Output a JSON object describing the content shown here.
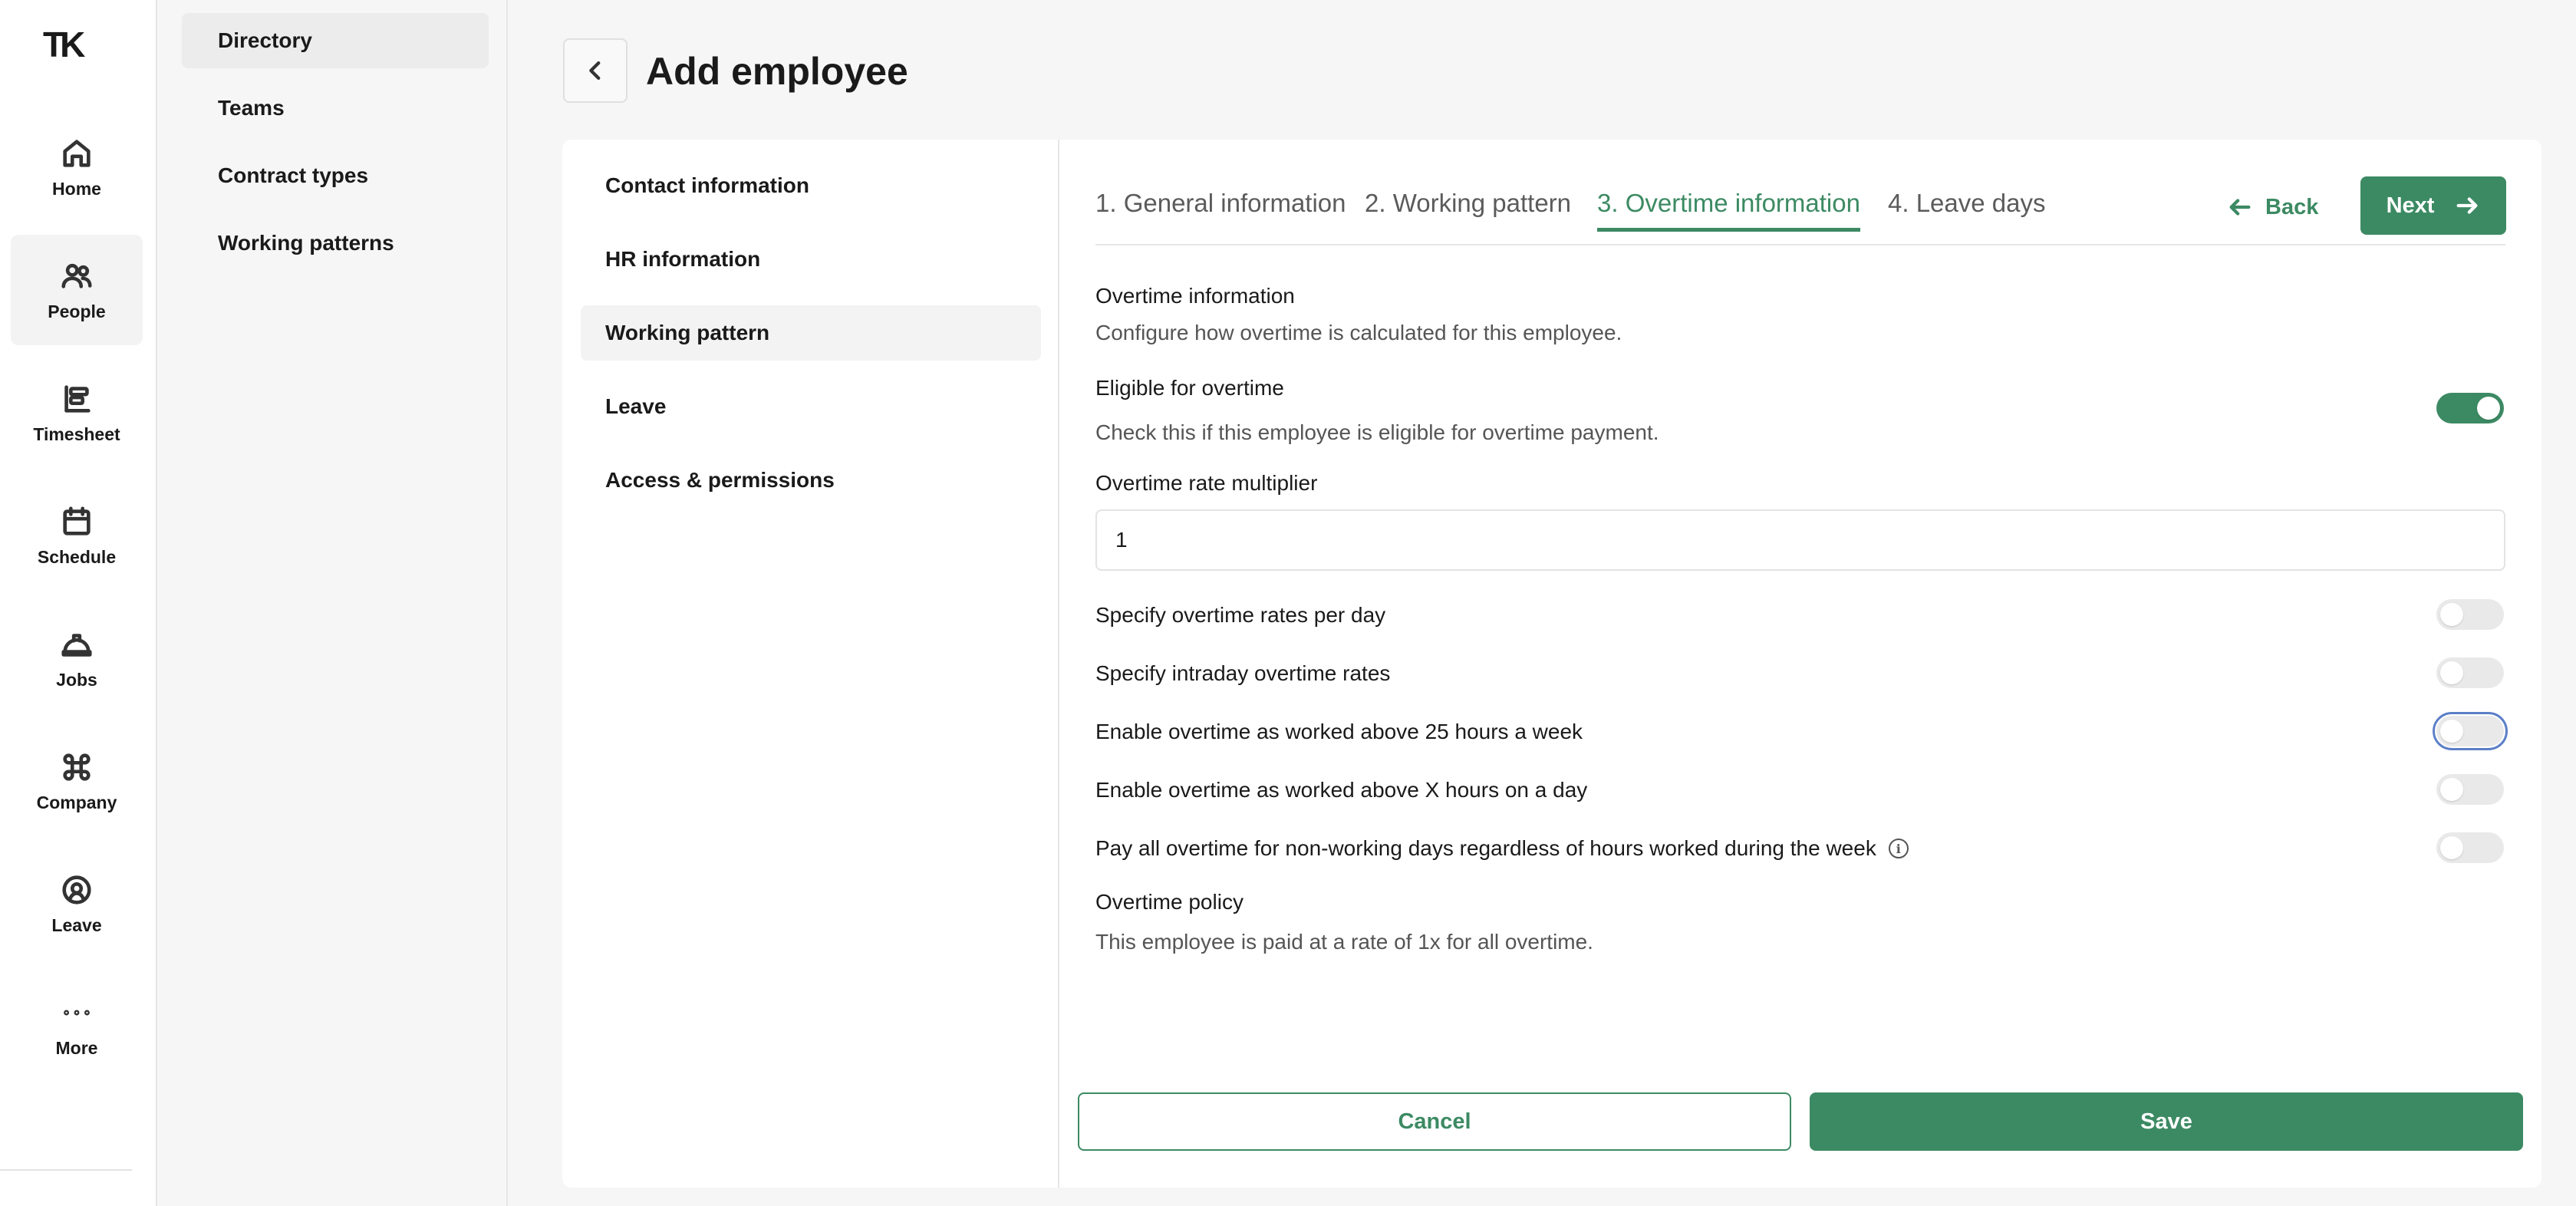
{
  "brand": {
    "logo_text": "TK"
  },
  "rail": {
    "items": [
      {
        "label": "Home",
        "icon": "home-icon"
      },
      {
        "label": "People",
        "icon": "people-icon"
      },
      {
        "label": "Timesheet",
        "icon": "timesheet-icon"
      },
      {
        "label": "Schedule",
        "icon": "calendar-icon"
      },
      {
        "label": "Jobs",
        "icon": "hardhat-icon"
      },
      {
        "label": "Company",
        "icon": "command-icon"
      },
      {
        "label": "Leave",
        "icon": "leave-icon"
      },
      {
        "label": "More",
        "icon": "more-dots-icon"
      }
    ],
    "active": "People"
  },
  "subnav": {
    "items": [
      "Directory",
      "Teams",
      "Contract types",
      "Working patterns"
    ],
    "active": "Directory"
  },
  "header": {
    "title": "Add employee"
  },
  "sections": {
    "items": [
      "Contact information",
      "HR information",
      "Working pattern",
      "Leave",
      "Access & permissions"
    ],
    "active": "Working pattern"
  },
  "steps": {
    "items": [
      "1. General information",
      "2. Working pattern",
      "3. Overtime information",
      "4. Leave days"
    ],
    "active": "3. Overtime information",
    "back_label": "Back",
    "next_label": "Next"
  },
  "form": {
    "overtime_heading": "Overtime information",
    "overtime_desc": "Configure how overtime is calculated for this employee.",
    "eligible_label": "Eligible for overtime",
    "eligible_desc": "Check this if this employee is eligible for overtime payment.",
    "eligible_on": true,
    "multiplier_label": "Overtime rate multiplier",
    "multiplier_value": "1",
    "toggles": [
      {
        "label": "Specify overtime rates per day",
        "on": false
      },
      {
        "label": "Specify intraday overtime rates",
        "on": false
      },
      {
        "label": "Enable overtime as worked above 25 hours a week",
        "on": false,
        "focused": true
      },
      {
        "label": "Enable overtime as worked above X hours on a day",
        "on": false
      },
      {
        "label": "Pay all overtime for non-working days regardless of hours worked during the week",
        "on": false,
        "info": true
      }
    ],
    "policy_heading": "Overtime policy",
    "policy_desc": "This employee is paid at a rate of 1x for all overtime."
  },
  "actions": {
    "cancel_label": "Cancel",
    "save_label": "Save"
  },
  "colors": {
    "accent": "#3c8a63",
    "focus": "#5c7fc7"
  }
}
